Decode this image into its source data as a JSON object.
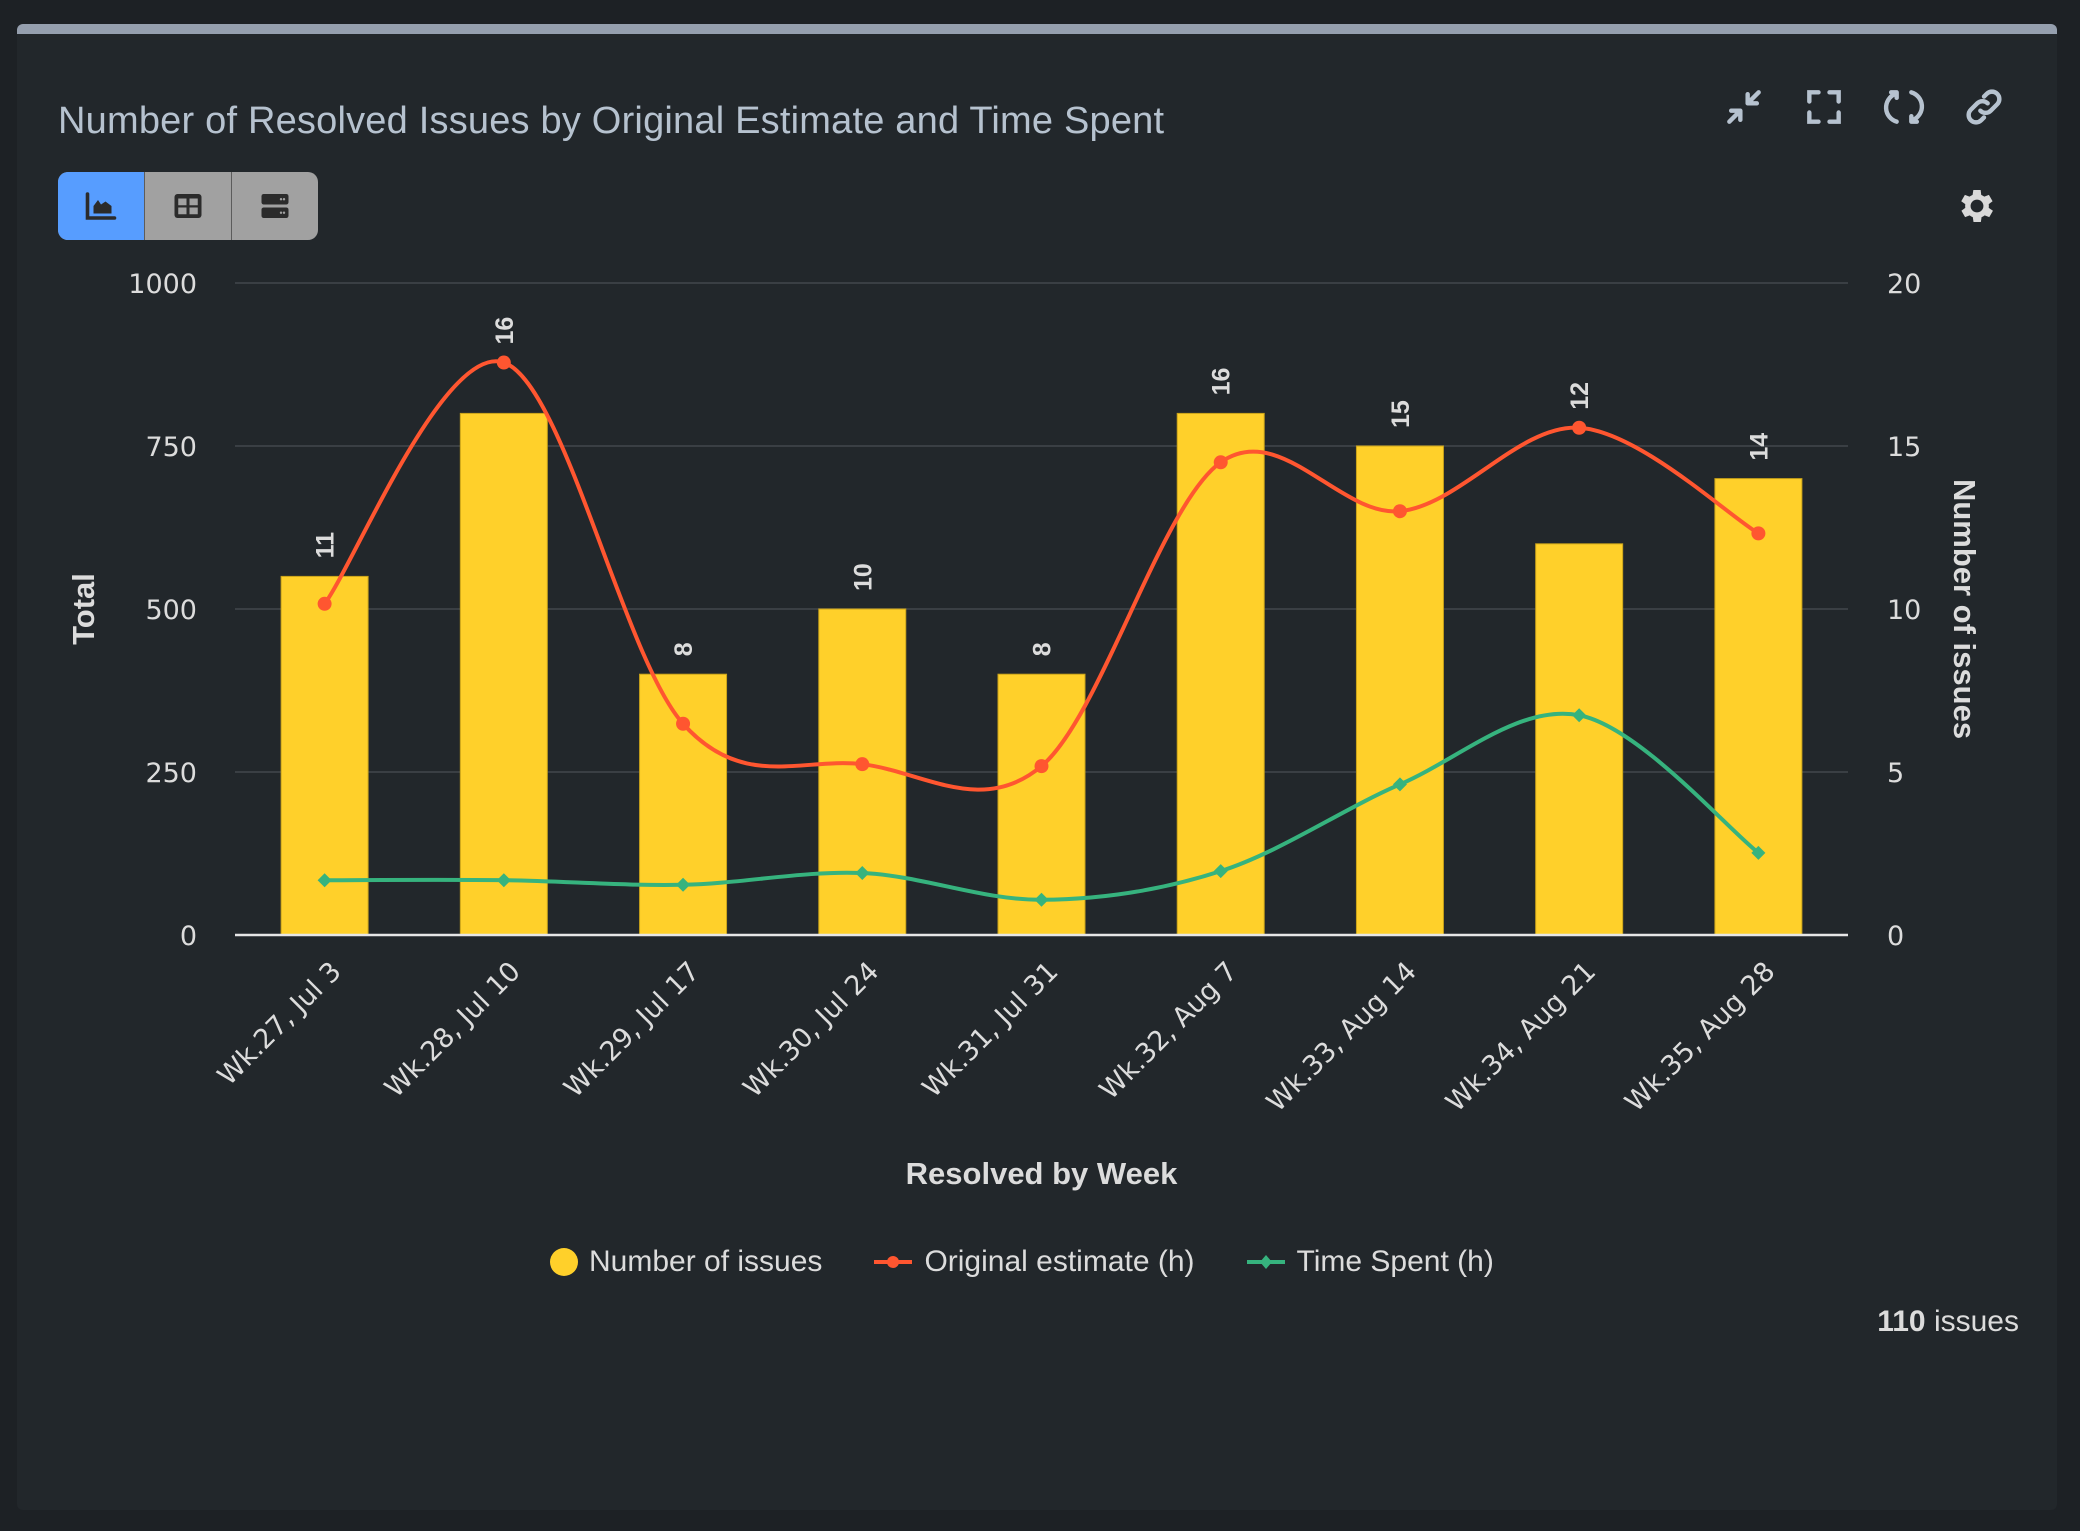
{
  "header": {
    "title": "Number of Resolved Issues by Original Estimate and Time Spent",
    "actions": [
      {
        "name": "collapse-icon",
        "label": "Collapse"
      },
      {
        "name": "fullscreen-icon",
        "label": "Fullscreen"
      },
      {
        "name": "refresh-icon",
        "label": "Refresh"
      },
      {
        "name": "link-icon",
        "label": "Copy link"
      }
    ]
  },
  "view_toggle": {
    "options": [
      {
        "name": "chart-view",
        "icon": "area-chart-icon",
        "active": true
      },
      {
        "name": "table-view",
        "icon": "table-icon",
        "active": false
      },
      {
        "name": "list-view",
        "icon": "list-icon",
        "active": false
      }
    ]
  },
  "settings_icon": "gear-icon",
  "colors": {
    "bar": "#ffd02a",
    "original_estimate": "#ff5630",
    "time_spent": "#36b37e",
    "active_toggle": "#579dff",
    "text": "#dcdcdc",
    "title": "#b6c2cf"
  },
  "chart_data": {
    "type": "bar",
    "title": "Number of Resolved Issues by Original Estimate and Time Spent",
    "xlabel": "Resolved by Week",
    "ylabel": "Total",
    "y2label": "Number of issues",
    "ylim": [
      0,
      1000
    ],
    "y2lim": [
      0,
      20
    ],
    "yticks": [
      "0",
      "250",
      "500",
      "750",
      "1000"
    ],
    "y2ticks": [
      "0",
      "5",
      "10",
      "15",
      "20"
    ],
    "grid": true,
    "legend_position": "bottom-center",
    "categories": [
      "Wk.27, Jul 3",
      "Wk.28, Jul 10",
      "Wk.29, Jul 17",
      "Wk.30, Jul 24",
      "Wk.31, Jul 31",
      "Wk.32, Aug 7",
      "Wk.33, Aug 14",
      "Wk.34, Aug 21",
      "Wk.35, Aug 28"
    ],
    "series": [
      {
        "name": "Number of issues",
        "type": "bar",
        "axis": "right",
        "values": [
          11,
          16,
          8,
          10,
          8,
          16,
          15,
          12,
          14
        ],
        "data_labels": true
      },
      {
        "name": "Original estimate (h)",
        "type": "line",
        "axis": "left",
        "marker": "circle",
        "values": [
          508,
          878,
          324,
          262,
          259,
          725,
          650,
          778,
          616
        ]
      },
      {
        "name": "Time Spent (h)",
        "type": "line",
        "axis": "left",
        "marker": "diamond",
        "values": [
          84,
          84,
          77,
          95,
          54,
          98,
          231,
          337,
          126
        ]
      }
    ]
  },
  "footer": {
    "count_value": "110",
    "count_label": " issues"
  }
}
